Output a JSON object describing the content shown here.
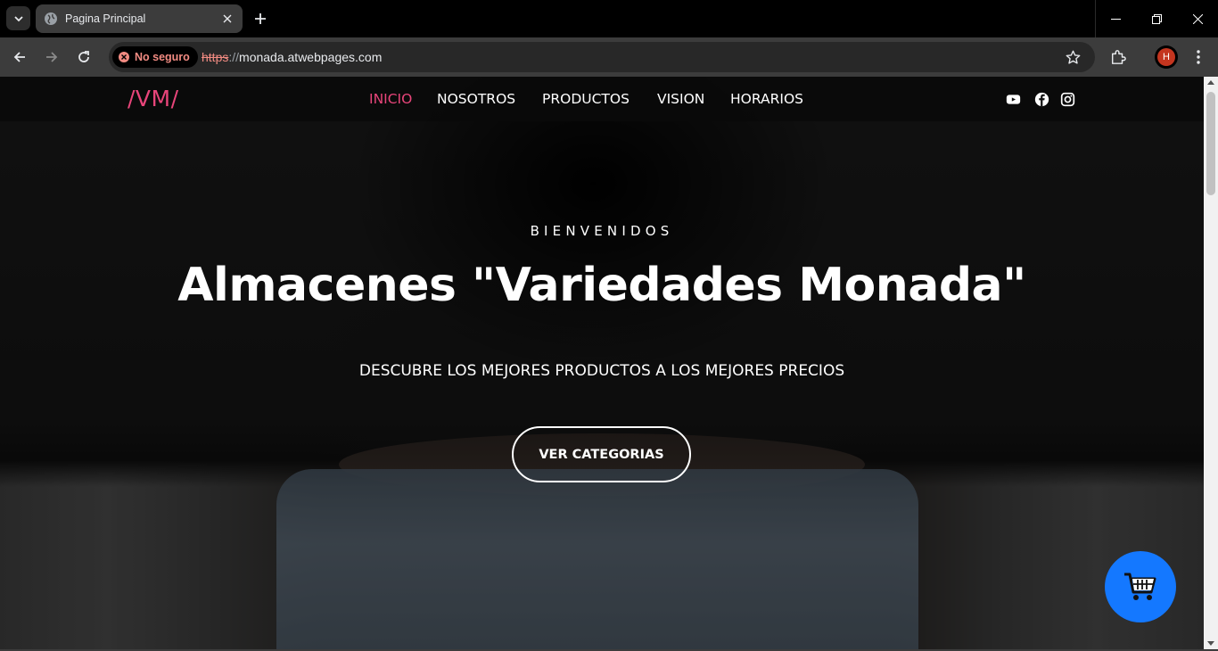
{
  "browser": {
    "tab_title": "Pagina Principal",
    "security_chip": "No seguro",
    "url_scheme": "https",
    "url_separator": "://",
    "url_host": "monada.atwebpages.com",
    "profile_initial": "H"
  },
  "nav": {
    "logo": "/VM/",
    "items": [
      {
        "label": "INICIO",
        "active": true
      },
      {
        "label": "NOSOTROS",
        "active": false
      },
      {
        "label": "PRODUCTOS",
        "active": false
      },
      {
        "label": "VISION",
        "active": false
      },
      {
        "label": "HORARIOS",
        "active": false
      }
    ],
    "social_icons": [
      "youtube-icon",
      "facebook-icon",
      "instagram-icon"
    ]
  },
  "hero": {
    "kicker": "BIENVENIDOS",
    "title": "Almacenes \"Variedades Monada\"",
    "subtitle": "DESCUBRE LOS MEJORES PRODUCTOS A LOS MEJORES PRECIOS",
    "cta_label": "VER CATEGORIAS"
  },
  "colors": {
    "accent": "#e8457a",
    "cart_button": "#1478ff",
    "warning": "#f28b82"
  },
  "cart_fab": {
    "icon": "shopping-cart-icon"
  }
}
